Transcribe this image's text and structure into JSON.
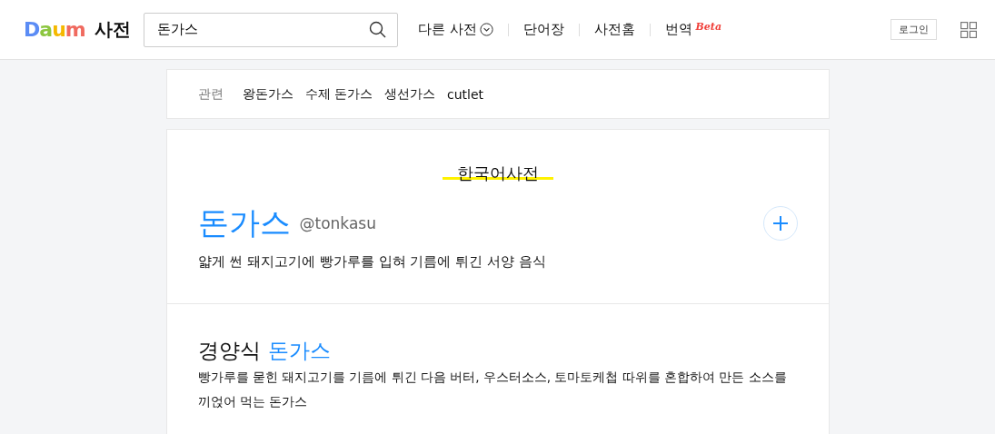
{
  "header": {
    "logo": "Daum",
    "service": "사전",
    "search": {
      "value": "돈가스"
    },
    "nav": [
      {
        "label": "다른 사전",
        "kind": "dropdown"
      },
      {
        "label": "단어장",
        "kind": "link"
      },
      {
        "label": "사전홈",
        "kind": "link"
      },
      {
        "label": "번역",
        "kind": "beta",
        "badge": "Beta"
      }
    ],
    "login": "로그인"
  },
  "related": {
    "label": "관련",
    "items": [
      "왕돈가스",
      "수제 돈가스",
      "생선가스",
      "cutlet"
    ]
  },
  "section_title": "한국어사전",
  "entry": {
    "word": "돈가스",
    "pronunciation": "@tonkasu",
    "meaning": "얇게 썬 돼지고기에 빵가루를 입혀 기름에 튀긴 서양 음식"
  },
  "subentries": [
    {
      "prefix": "경양식",
      "word": "돈가스",
      "meaning": "빵가루를 묻힌 돼지고기를 기름에 튀긴 다음 버터, 우스터소스, 토마토케첩 따위를 혼합하여 만든 소스를 끼얹어 먹는 돈가스"
    }
  ]
}
